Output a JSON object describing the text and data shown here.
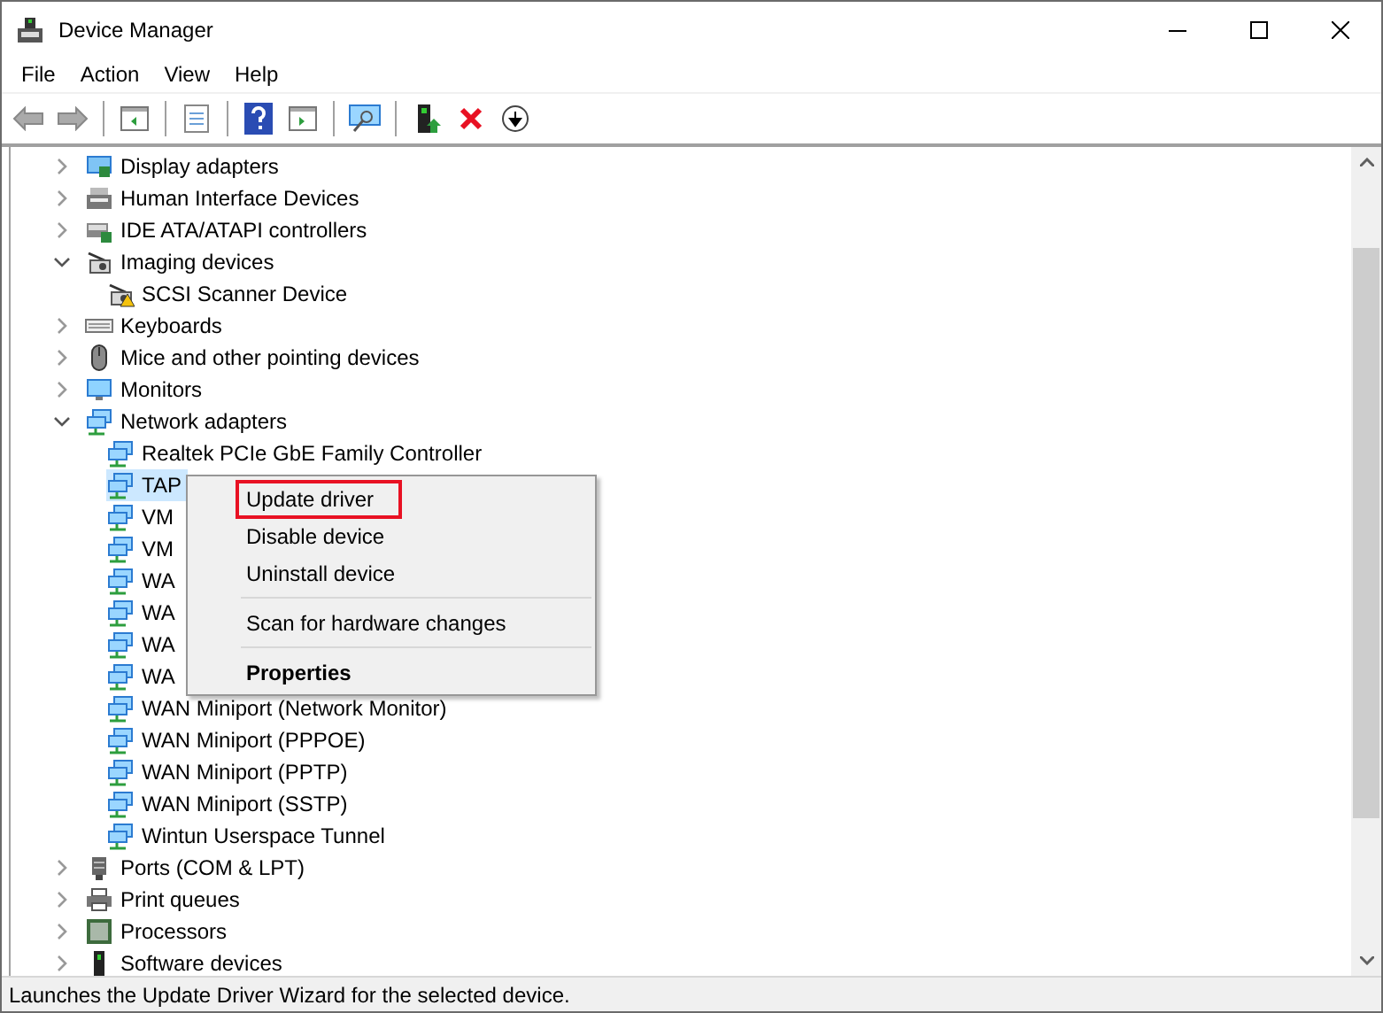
{
  "window": {
    "title": "Device Manager"
  },
  "menu": [
    "File",
    "Action",
    "View",
    "Help"
  ],
  "tree": [
    {
      "label": "Display adapters",
      "kind": "display",
      "expanded": false,
      "selected": false
    },
    {
      "label": "Human Interface Devices",
      "kind": "hid",
      "expanded": false,
      "selected": false
    },
    {
      "label": "IDE ATA/ATAPI controllers",
      "kind": "ide",
      "expanded": false,
      "selected": false
    },
    {
      "label": "Imaging devices",
      "kind": "camera",
      "expanded": true,
      "selected": false,
      "children": [
        {
          "label": "SCSI Scanner Device",
          "kind": "camera-warning",
          "selected": false
        }
      ]
    },
    {
      "label": "Keyboards",
      "kind": "keyboard",
      "expanded": false,
      "selected": false
    },
    {
      "label": "Mice and other pointing devices",
      "kind": "mouse",
      "expanded": false,
      "selected": false
    },
    {
      "label": "Monitors",
      "kind": "monitor",
      "expanded": false,
      "selected": false
    },
    {
      "label": "Network adapters",
      "kind": "network",
      "expanded": true,
      "selected": false,
      "children": [
        {
          "label": "Realtek PCIe GbE Family Controller",
          "kind": "network",
          "selected": false
        },
        {
          "label": "TAP",
          "kind": "network",
          "selected": true
        },
        {
          "label": "VM",
          "kind": "network",
          "selected": false
        },
        {
          "label": "VM",
          "kind": "network",
          "selected": false
        },
        {
          "label": "WA",
          "kind": "network",
          "selected": false
        },
        {
          "label": "WA",
          "kind": "network",
          "selected": false
        },
        {
          "label": "WA",
          "kind": "network",
          "selected": false
        },
        {
          "label": "WA",
          "kind": "network",
          "selected": false
        },
        {
          "label": "WAN Miniport (Network Monitor)",
          "kind": "network",
          "selected": false
        },
        {
          "label": "WAN Miniport (PPPOE)",
          "kind": "network",
          "selected": false
        },
        {
          "label": "WAN Miniport (PPTP)",
          "kind": "network",
          "selected": false
        },
        {
          "label": "WAN Miniport (SSTP)",
          "kind": "network",
          "selected": false
        },
        {
          "label": "Wintun Userspace Tunnel",
          "kind": "network",
          "selected": false
        }
      ]
    },
    {
      "label": "Ports (COM & LPT)",
      "kind": "port",
      "expanded": false,
      "selected": false
    },
    {
      "label": "Print queues",
      "kind": "printer",
      "expanded": false,
      "selected": false
    },
    {
      "label": "Processors",
      "kind": "cpu",
      "expanded": false,
      "selected": false
    },
    {
      "label": "Software devices",
      "kind": "software",
      "expanded": false,
      "selected": false
    }
  ],
  "context_menu": [
    {
      "kind": "item",
      "label": "Update driver",
      "highlighted": true,
      "bold": false
    },
    {
      "kind": "item",
      "label": "Disable device",
      "highlighted": false,
      "bold": false
    },
    {
      "kind": "item",
      "label": "Uninstall device",
      "highlighted": false,
      "bold": false
    },
    {
      "kind": "separator"
    },
    {
      "kind": "item",
      "label": "Scan for hardware changes",
      "highlighted": false,
      "bold": false
    },
    {
      "kind": "separator"
    },
    {
      "kind": "item",
      "label": "Properties",
      "highlighted": false,
      "bold": true
    }
  ],
  "status_bar": "Launches the Update Driver Wizard for the selected device."
}
